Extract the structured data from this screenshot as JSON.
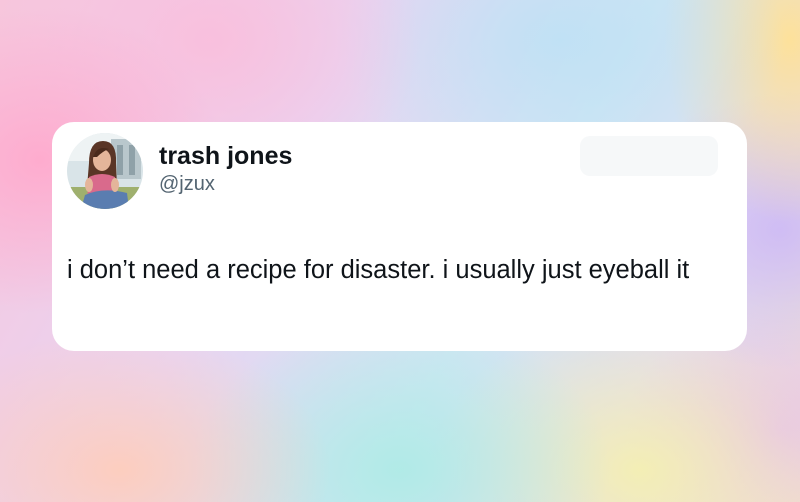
{
  "post": {
    "author_name": "trash jones",
    "author_handle": "@jzux",
    "text": "i don’t need a recipe for disaster. i usually just eyeball it"
  }
}
